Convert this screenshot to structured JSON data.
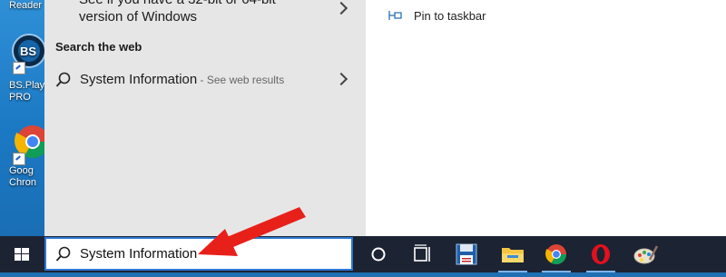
{
  "desktop": {
    "icons": [
      {
        "label": "Reader"
      },
      {
        "label": "BS.Play PRO"
      },
      {
        "label": "Goog Chron"
      }
    ]
  },
  "results": {
    "top_item_line1": "See if you have a 32-bit or 64-bit",
    "top_item_line2": "version of Windows",
    "section_title": "Search the web",
    "web_item_title": "System Information",
    "web_item_suffix": " - See web results"
  },
  "actions": {
    "pin_taskbar": "Pin to taskbar"
  },
  "search": {
    "value": "System Information"
  },
  "taskbar": {
    "icons": [
      "cortana-circle-icon",
      "task-view-icon",
      "floppy-save-icon",
      "file-explorer-icon",
      "chrome-icon",
      "opera-icon",
      "paint-icon"
    ]
  },
  "colors": {
    "accent": "#2b78d4",
    "arrow": "#e8201a",
    "taskbar": "#1c2333"
  }
}
